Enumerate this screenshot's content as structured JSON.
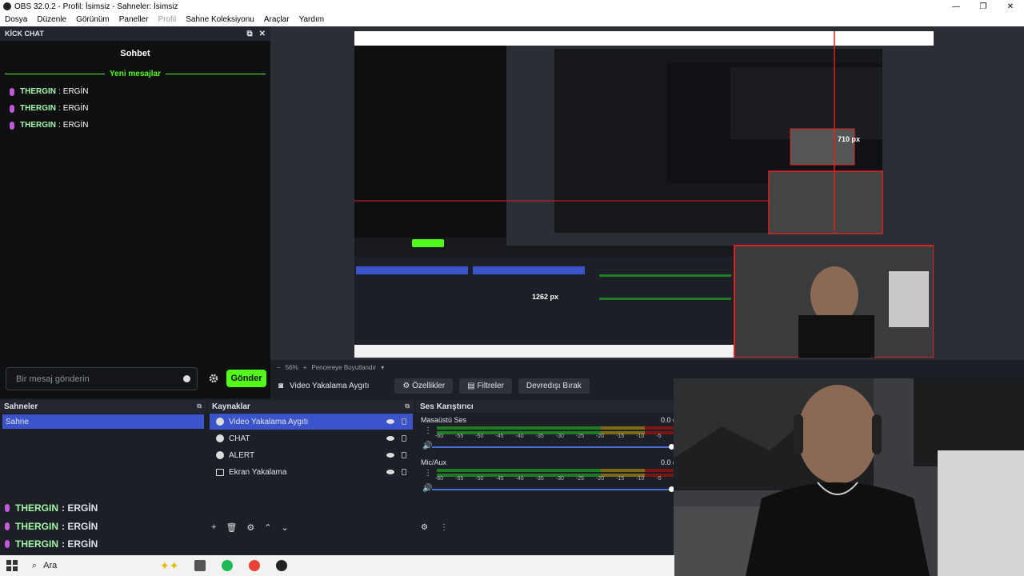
{
  "window": {
    "title": "OBS 32.0.2 - Profil: İsimsiz - Sahneler: İsimsiz"
  },
  "menu": {
    "items": [
      "Dosya",
      "Düzenle",
      "Görünüm",
      "Paneller",
      "Profil",
      "Sahne Koleksiyonu",
      "Araçlar",
      "Yardım"
    ]
  },
  "chat_dock": {
    "header": "KİCK CHAT",
    "title": "Sohbet",
    "new_messages": "Yeni mesajlar",
    "messages": [
      {
        "user": "THERGIN",
        "sep": ":",
        "text": "ERGİN"
      },
      {
        "user": "THERGIN",
        "sep": ":",
        "text": "ERGİN"
      },
      {
        "user": "THERGIN",
        "sep": ":",
        "text": "ERGİN"
      }
    ],
    "input_placeholder": "Bir mesaj gönderin",
    "send_label": "Gönder"
  },
  "preview": {
    "zoom": "56%",
    "fit_label": "Pencereye Boyutlandır",
    "dim_width": "1262 px",
    "dim_height": "710 px"
  },
  "context_bar": {
    "source_name": "Video Yakalama Aygıtı",
    "properties": "Özellikler",
    "filters": "Filtreler",
    "deactivate": "Devredışı Bırak"
  },
  "scenes": {
    "header": "Sahneler",
    "items": [
      "Sahne"
    ]
  },
  "sources": {
    "header": "Kaynaklar",
    "items": [
      "Video Yakalama Aygıtı",
      "CHAT",
      "ALERT",
      "Ekran Yakalama"
    ]
  },
  "mixer": {
    "header": "Ses Karıştırıcı",
    "tracks": [
      {
        "name": "Masaüstü Ses",
        "level": "0.0 d"
      },
      {
        "name": "Mic/Aux",
        "level": "0.0 d"
      }
    ],
    "scale": [
      "-60",
      "-55",
      "-50",
      "-45",
      "-40",
      "-35",
      "-30",
      "-25",
      "-20",
      "-15",
      "-10",
      "-5"
    ]
  },
  "overlay_chat": [
    {
      "user": "THERGIN",
      "text": ": ERGİN"
    },
    {
      "user": "THERGIN",
      "text": ": ERGİN"
    },
    {
      "user": "THERGIN",
      "text": ": ERGİN"
    }
  ],
  "taskbar": {
    "search": "Ara"
  },
  "colors": {
    "kick_green": "#53fc18",
    "selected": "#3b54cc",
    "obs_bg": "#1d1f26"
  }
}
